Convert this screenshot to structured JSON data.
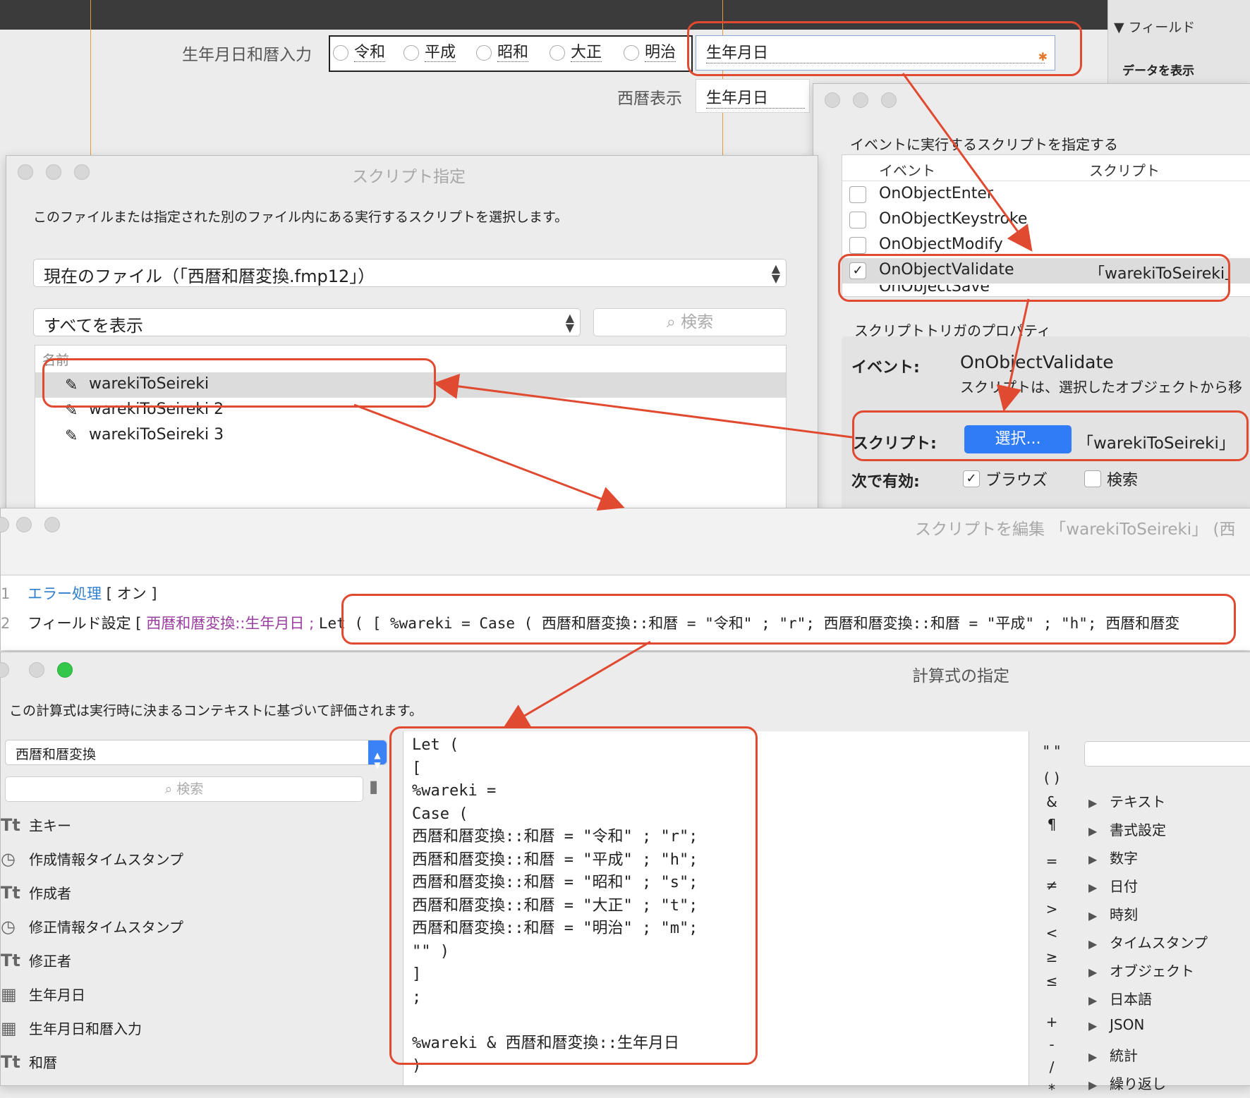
{
  "layout": {
    "label_wareki_input": "生年月日和暦入力",
    "radios": [
      "令和",
      "平成",
      "昭和",
      "大正",
      "明治"
    ],
    "field_birthdate": "生年月日",
    "label_seireki": "西暦表示",
    "field_birthdate2": "生年月日"
  },
  "right_panel": {
    "header": "▼ フィールド",
    "sub": "データを表示"
  },
  "script_dialog": {
    "title": "スクリプト指定",
    "description": "このファイルまたは指定された別のファイル内にある実行するスクリプトを選択します。",
    "file_popup": "現在のファイル（「西暦和暦変換.fmp12」）",
    "filter_popup": "すべてを表示",
    "search_placeholder": "検索",
    "list_header": "名前",
    "scripts": [
      "warekiToSeireki",
      "warekiToSeireki 2",
      "warekiToSeireki 3"
    ]
  },
  "trigger_dialog": {
    "heading": "イベントに実行するスクリプトを指定する",
    "col_event": "イベント",
    "col_script": "スクリプト",
    "events": [
      {
        "name": "OnObjectEnter",
        "checked": false,
        "script": ""
      },
      {
        "name": "OnObjectKeystroke",
        "checked": false,
        "script": ""
      },
      {
        "name": "OnObjectModify",
        "checked": false,
        "script": ""
      },
      {
        "name": "OnObjectValidate",
        "checked": true,
        "script": "「warekiToSeireki」"
      },
      {
        "name": "OnObjectSave",
        "checked": false,
        "script": ""
      }
    ],
    "props_heading": "スクリプトトリガのプロパティ",
    "event_label": "イベント:",
    "event_value": "OnObjectValidate",
    "event_desc": "スクリプトは、選択したオブジェクトから移",
    "script_label": "スクリプト:",
    "select_button": "選択...",
    "script_value": "「warekiToSeireki」",
    "enabled_label": "次で有効:",
    "browse_label": "ブラウズ",
    "find_label": "検索"
  },
  "edit_window": {
    "title": "スクリプトを編集 「warekiToSeireki」 (西",
    "lines": [
      {
        "num": "1",
        "step": "エラー処理",
        "args": "[ オン ]"
      },
      {
        "num": "2",
        "step": "フィールド設定",
        "bracket": "[",
        "target": "西暦和暦変換::生年月日",
        "sep": ";",
        "calc": "Let ( [ %wareki = Case ( 西暦和暦変換::和暦 = \"令和\" ; \"r\"; 西暦和暦変換::和暦 = \"平成\" ; \"h\"; 西暦和暦変"
      }
    ]
  },
  "calc_window": {
    "title": "計算式の指定",
    "description": "この計算式は実行時に決まるコンテキストに基づいて評価されます。",
    "table_popup": "西暦和暦変換",
    "search_placeholder": "検索",
    "fields": [
      {
        "icon": "text-field-icon",
        "glyph": "Tt",
        "name": "主キー"
      },
      {
        "icon": "timestamp-field-icon",
        "glyph": "◷",
        "name": "作成情報タイムスタンプ"
      },
      {
        "icon": "text-field-icon",
        "glyph": "Tt",
        "name": "作成者"
      },
      {
        "icon": "timestamp-field-icon",
        "glyph": "◷",
        "name": "修正情報タイムスタンプ"
      },
      {
        "icon": "text-field-icon",
        "glyph": "Tt",
        "name": "修正者"
      },
      {
        "icon": "date-field-icon",
        "glyph": "▦",
        "name": "生年月日"
      },
      {
        "icon": "date-field-icon",
        "glyph": "▦",
        "name": "生年月日和暦入力"
      },
      {
        "icon": "text-field-icon",
        "glyph": "Tt",
        "name": "和暦"
      }
    ],
    "formula": [
      "Let (",
      "[",
      "%wareki =",
      "Case (",
      "西暦和暦変換::和暦 = \"令和\" ; \"r\";",
      "西暦和暦変換::和暦 = \"平成\" ; \"h\";",
      "西暦和暦変換::和暦 = \"昭和\" ; \"s\";",
      "西暦和暦変換::和暦 = \"大正\" ; \"t\";",
      "西暦和暦変換::和暦 = \"明治\" ; \"m\";",
      "\"\" )",
      "]",
      ";",
      "",
      "%wareki & 西暦和暦変換::生年月日",
      ")"
    ],
    "operators": [
      "\" \"",
      "( )",
      "&",
      "¶",
      "=",
      "≠",
      ">",
      "<",
      "≥",
      "≤",
      "+",
      "-",
      "/",
      "*"
    ],
    "functions": [
      "テキスト",
      "書式設定",
      "数字",
      "日付",
      "時刻",
      "タイムスタンプ",
      "オブジェクト",
      "日本語",
      "JSON",
      "統計",
      "繰り返し"
    ]
  },
  "colors": {
    "highlight": "#e04a31",
    "button_blue": "#2f7cf6",
    "step_blue": "#2f7fce",
    "field_purple": "#9b3ea0"
  }
}
